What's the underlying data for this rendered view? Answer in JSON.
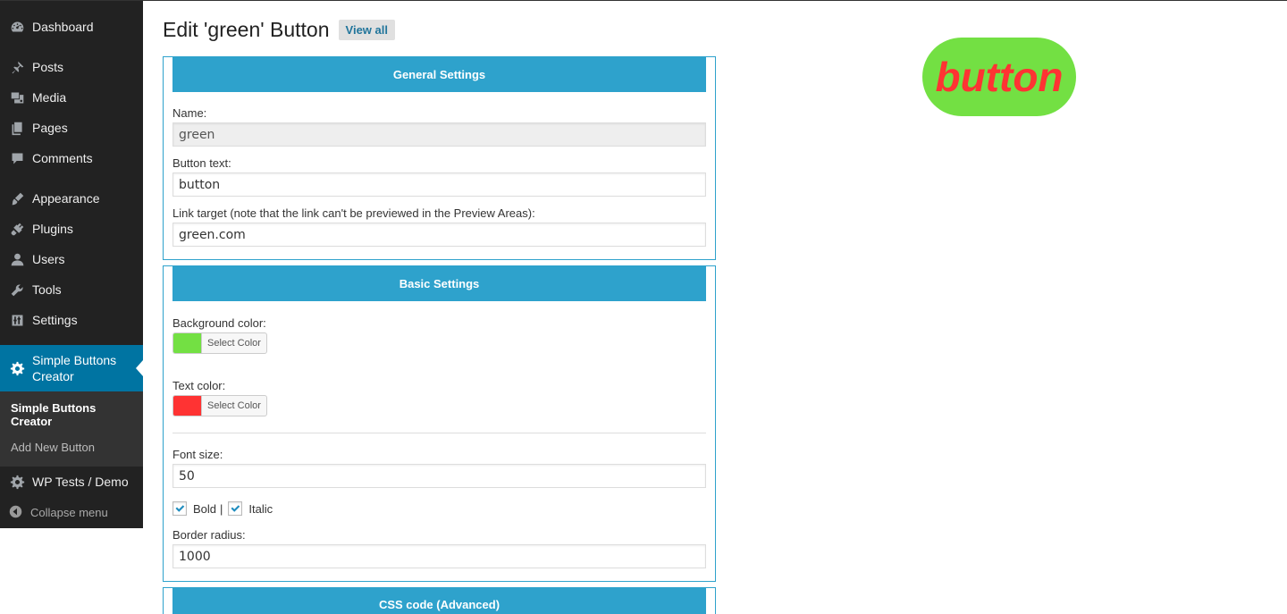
{
  "sidebar": {
    "items": [
      {
        "label": "Dashboard",
        "icon": "dashboard-icon"
      },
      {
        "label": "Posts",
        "icon": "pin-icon"
      },
      {
        "label": "Media",
        "icon": "media-icon"
      },
      {
        "label": "Pages",
        "icon": "pages-icon"
      },
      {
        "label": "Comments",
        "icon": "comment-icon"
      },
      {
        "label": "Appearance",
        "icon": "paintbrush-icon"
      },
      {
        "label": "Plugins",
        "icon": "plug-icon"
      },
      {
        "label": "Users",
        "icon": "user-icon"
      },
      {
        "label": "Tools",
        "icon": "wrench-icon"
      },
      {
        "label": "Settings",
        "icon": "settings-icon"
      }
    ],
    "active": {
      "label": "Simple Buttons Creator",
      "icon": "gear-icon"
    },
    "submenu": [
      {
        "label": "Simple Buttons Creator"
      },
      {
        "label": "Add New Button"
      }
    ],
    "after": {
      "label": "WP Tests / Demo",
      "icon": "gear-icon"
    },
    "collapse_label": "Collapse menu"
  },
  "header": {
    "title": "Edit 'green' Button",
    "view_all": "View all"
  },
  "general": {
    "heading": "General Settings",
    "name_label": "Name:",
    "name_value": "green",
    "text_label": "Button text:",
    "text_value": "button",
    "link_label": "Link target (note that the link can't be previewed in the Preview Areas):",
    "link_value": "green.com"
  },
  "basic": {
    "heading": "Basic Settings",
    "bg_label": "Background color:",
    "bg_color": "#73e043",
    "text_color_label": "Text color:",
    "text_color": "#ff3333",
    "select_color_label": "Select Color",
    "font_size_label": "Font size:",
    "font_size_value": "50",
    "bold_label": "Bold",
    "separator": "|",
    "italic_label": "Italic",
    "bold_checked": true,
    "italic_checked": true,
    "radius_label": "Border radius:",
    "radius_value": "1000"
  },
  "css": {
    "heading": "CSS code (Advanced)"
  },
  "preview": {
    "text": "button",
    "bg": "#73e043",
    "color": "#ff3333"
  }
}
